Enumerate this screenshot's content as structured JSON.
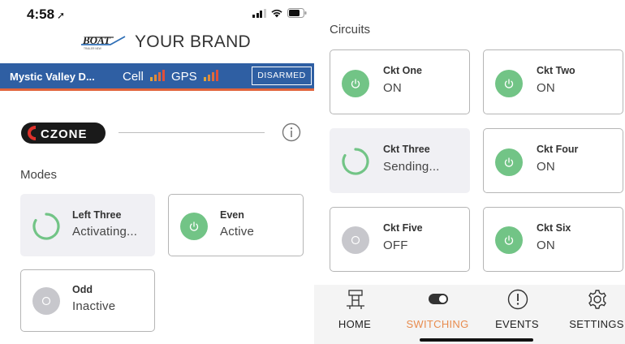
{
  "left_phone": {
    "status": {
      "time": "4:58",
      "location_arrow": "➚"
    },
    "brand": {
      "logo_text": "BOAT",
      "logo_subtext": "TRAILER NEW",
      "name": "YOUR BRAND"
    },
    "infobar": {
      "vessel": "Mystic Valley D...",
      "cell_label": "Cell",
      "gps_label": "GPS",
      "alarm_button": "DISARMED",
      "signal_colors": [
        "#e0a53a",
        "#e08a3a",
        "#e06c3a",
        "#e04f3a"
      ]
    },
    "czone_logo": "CZONE",
    "modes": {
      "title": "Modes",
      "items": [
        {
          "name": "Left Three",
          "state": "Activating...",
          "status": "pending"
        },
        {
          "name": "Even",
          "state": "Active",
          "status": "on"
        },
        {
          "name": "Odd",
          "state": "Inactive",
          "status": "off"
        }
      ]
    }
  },
  "right_phone": {
    "circuits": {
      "title": "Circuits",
      "items": [
        {
          "name": "Ckt One",
          "state": "ON",
          "status": "on"
        },
        {
          "name": "Ckt Two",
          "state": "ON",
          "status": "on"
        },
        {
          "name": "Ckt Three",
          "state": "Sending...",
          "status": "pending"
        },
        {
          "name": "Ckt Four",
          "state": "ON",
          "status": "on"
        },
        {
          "name": "Ckt Five",
          "state": "OFF",
          "status": "off"
        },
        {
          "name": "Ckt Six",
          "state": "ON",
          "status": "on"
        }
      ]
    },
    "tabs": [
      {
        "label": "HOME",
        "icon": "boat-helm-icon",
        "active": false
      },
      {
        "label": "SWITCHING",
        "icon": "toggle-switch-icon",
        "active": true
      },
      {
        "label": "EVENTS",
        "icon": "alert-circle-icon",
        "active": false
      },
      {
        "label": "SETTINGS",
        "icon": "gear-icon",
        "active": false
      }
    ]
  },
  "colors": {
    "accent": "#2f5fa3",
    "accent_underline": "#e1643c",
    "on_green": "#72c486",
    "off_gray": "#c7c7cc",
    "active_tab": "#e88c4e"
  }
}
